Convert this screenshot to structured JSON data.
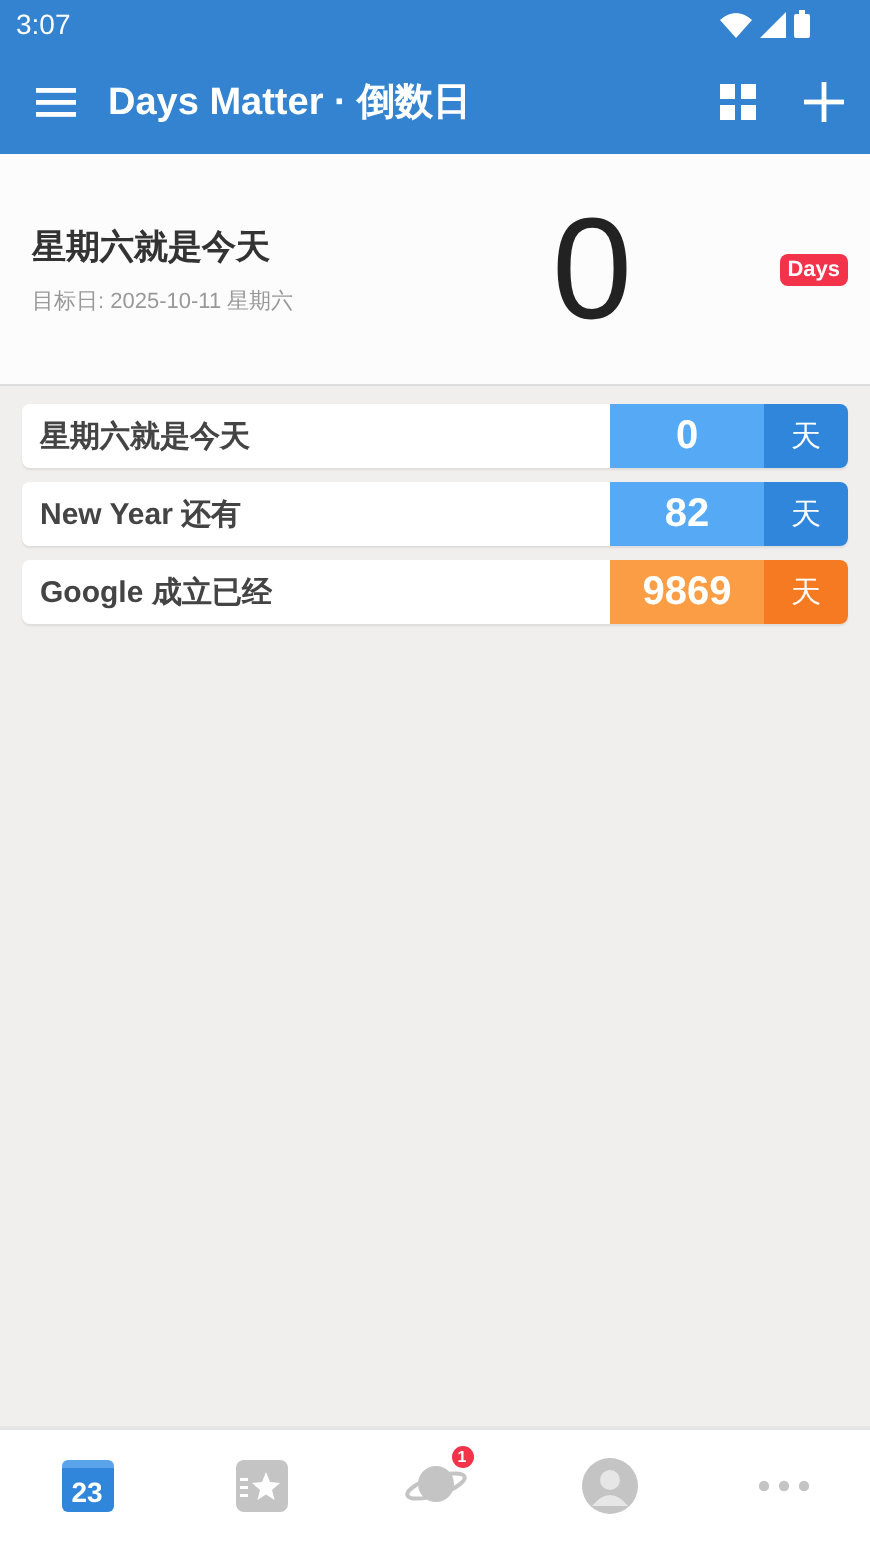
{
  "status_bar": {
    "time": "3:07"
  },
  "app_bar": {
    "title": "Days Matter · 倒数日"
  },
  "hero": {
    "title": "星期六就是今天",
    "subtitle": "目标日: 2025-10-11 星期六",
    "count": "0",
    "badge": "Days"
  },
  "events": [
    {
      "title": "星期六就是今天",
      "count": "0",
      "unit": "天",
      "kind": "countdown"
    },
    {
      "title": "New Year 还有",
      "count": "82",
      "unit": "天",
      "kind": "countdown"
    },
    {
      "title": "Google 成立已经",
      "count": "9869",
      "unit": "天",
      "kind": "elapsed"
    }
  ],
  "bottom_nav": [
    {
      "kind": "calendar",
      "icon_text": "23",
      "selected": true
    },
    {
      "kind": "star",
      "selected": false
    },
    {
      "kind": "planet",
      "badge": "1",
      "selected": false
    },
    {
      "kind": "profile",
      "selected": false
    },
    {
      "kind": "more",
      "selected": false
    }
  ]
}
